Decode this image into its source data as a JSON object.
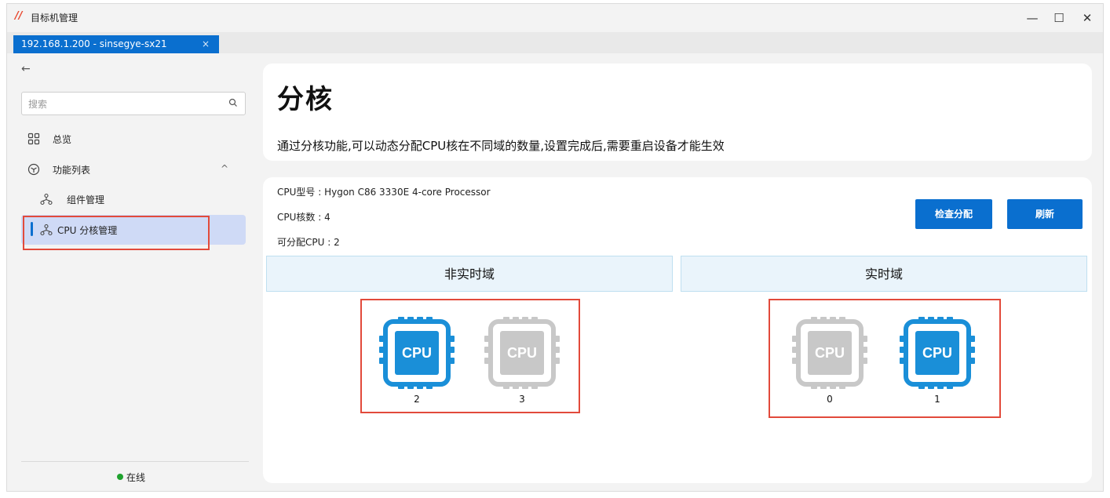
{
  "window": {
    "title": "目标机管理",
    "logo_text": "//",
    "controls": {
      "minimize": "—",
      "maximize": "☐",
      "close": "✕"
    }
  },
  "tab": {
    "label": "192.168.1.200 - sinsegye-sx21",
    "close": "×"
  },
  "sidebar": {
    "back": "←",
    "search_placeholder": "搜索",
    "items": [
      {
        "label": "总览",
        "icon": "grid-icon"
      },
      {
        "label": "功能列表",
        "icon": "cube-icon",
        "chevron": "^"
      },
      {
        "label": "组件管理",
        "icon": "network-icon"
      },
      {
        "label": "CPU 分核管理",
        "icon": "network-icon",
        "active": true
      }
    ],
    "status": "在线"
  },
  "header": {
    "title": "分核",
    "description": "通过分核功能,可以动态分配CPU核在不同域的数量,设置完成后,需要重启设备才能生效"
  },
  "info": {
    "model": "CPU型号 : Hygon C86 3330E 4-core Processor",
    "cores": "CPU核数 : 4",
    "allocatable": "可分配CPU : 2"
  },
  "buttons": {
    "check": "检查分配",
    "refresh": "刷新"
  },
  "domains": {
    "non_realtime": {
      "title": "非实时域",
      "cpus": [
        {
          "id": "2",
          "text": "CPU",
          "active": true
        },
        {
          "id": "3",
          "text": "CPU",
          "active": false
        }
      ]
    },
    "realtime": {
      "title": "实时域",
      "cpus": [
        {
          "id": "0",
          "text": "CPU",
          "active": false
        },
        {
          "id": "1",
          "text": "CPU",
          "active": true
        }
      ]
    }
  },
  "colors": {
    "accent": "#0a6fcf",
    "cpu_active": "#1a8fd8",
    "cpu_inactive": "#c8c8c8",
    "highlight": "#e24a3b",
    "online": "#1fa22e"
  }
}
